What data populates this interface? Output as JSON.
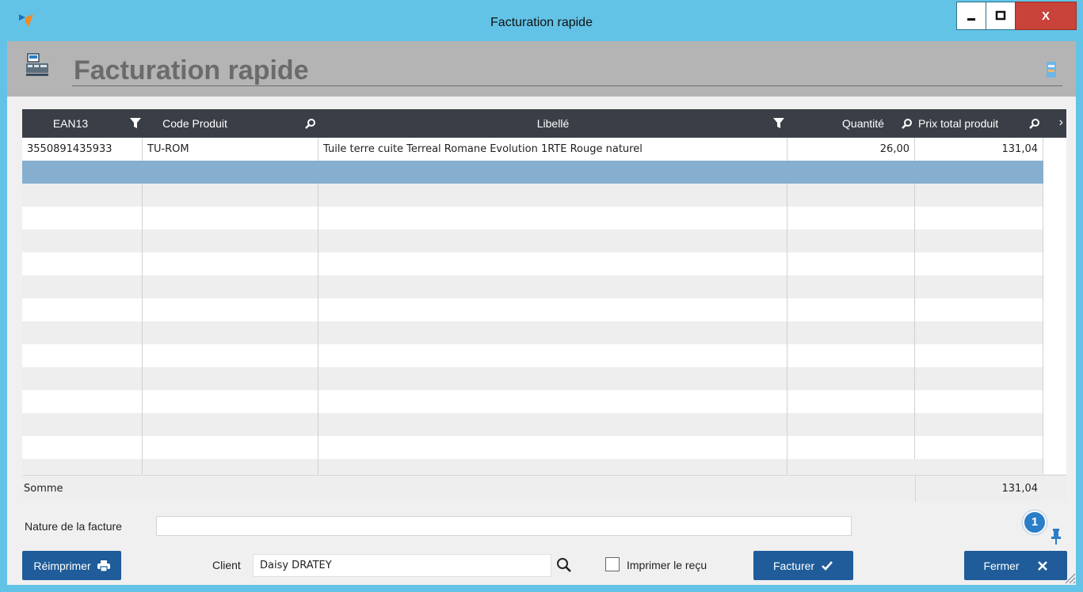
{
  "window": {
    "title": "Facturation rapide",
    "minimize": "_",
    "maximize": "□",
    "close": "X"
  },
  "header": {
    "title": "Facturation rapide"
  },
  "grid": {
    "columns": [
      {
        "label": "EAN13",
        "tool": "filter-icon"
      },
      {
        "label": "Code Produit",
        "tool": "search-icon"
      },
      {
        "label": "Libellé",
        "tool": "filter-icon"
      },
      {
        "label": "Quantité",
        "tool": "search-icon"
      },
      {
        "label": "Prix total produit",
        "tool": "search-icon"
      }
    ],
    "rows": [
      {
        "ean": "3550891435933",
        "code": "TU-ROM",
        "libelle": "Tuile terre cuite Terreal Romane Evolution 1RTE Rouge naturel",
        "quantite": "26,00",
        "prix": "131,04"
      }
    ],
    "sum_label": "Somme",
    "sum_value": "131,04"
  },
  "form": {
    "nature_label": "Nature de la facture",
    "nature_value": "",
    "client_label": "Client",
    "client_value": "Daisy DRATEY",
    "print_receipt_label": "Imprimer le reçu",
    "print_receipt_checked": false
  },
  "buttons": {
    "reimprimer": "Réimprimer",
    "facturer": "Facturer",
    "fermer": "Fermer"
  },
  "badge": {
    "count": "1"
  },
  "colors": {
    "titlebar": "#62c3e6",
    "grid_header": "#3a3f47",
    "selected_row": "#86aece",
    "button": "#1f5c99",
    "close": "#c9433a"
  }
}
